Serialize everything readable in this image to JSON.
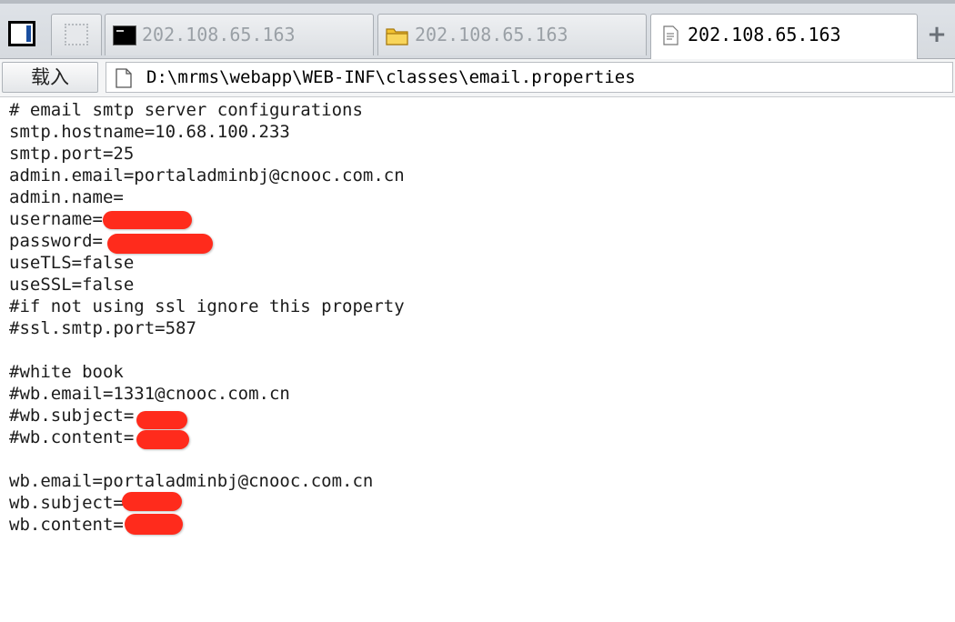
{
  "tabs": [
    {
      "label": "202.108.65.163",
      "icon": "terminal-icon",
      "active": false
    },
    {
      "label": "202.108.65.163",
      "icon": "folder-icon",
      "active": false
    },
    {
      "label": "202.108.65.163",
      "icon": "file-icon",
      "active": true
    }
  ],
  "toolbar": {
    "load_label": "载入",
    "path": "D:\\mrms\\webapp\\WEB-INF\\classes\\email.properties",
    "new_tab_label": "+"
  },
  "editor": {
    "lines": [
      "# email smtp server configurations",
      "smtp.hostname=10.68.100.233",
      "smtp.port=25",
      "admin.email=portaladminbj@cnooc.com.cn",
      "admin.name=",
      "username=",
      "password=",
      "useTLS=false",
      "useSSL=false",
      "#if not using ssl ignore this property",
      "#ssl.smtp.port=587",
      "",
      "#white book",
      "#wb.email=1331@cnooc.com.cn",
      "#wb.subject=",
      "#wb.content=",
      "",
      "wb.email=portaladminbj@cnooc.com.cn",
      "wb.subject=",
      "wb.content="
    ]
  },
  "colors": {
    "redaction": "#ff2b1c",
    "accent": "#1a4fa0"
  }
}
